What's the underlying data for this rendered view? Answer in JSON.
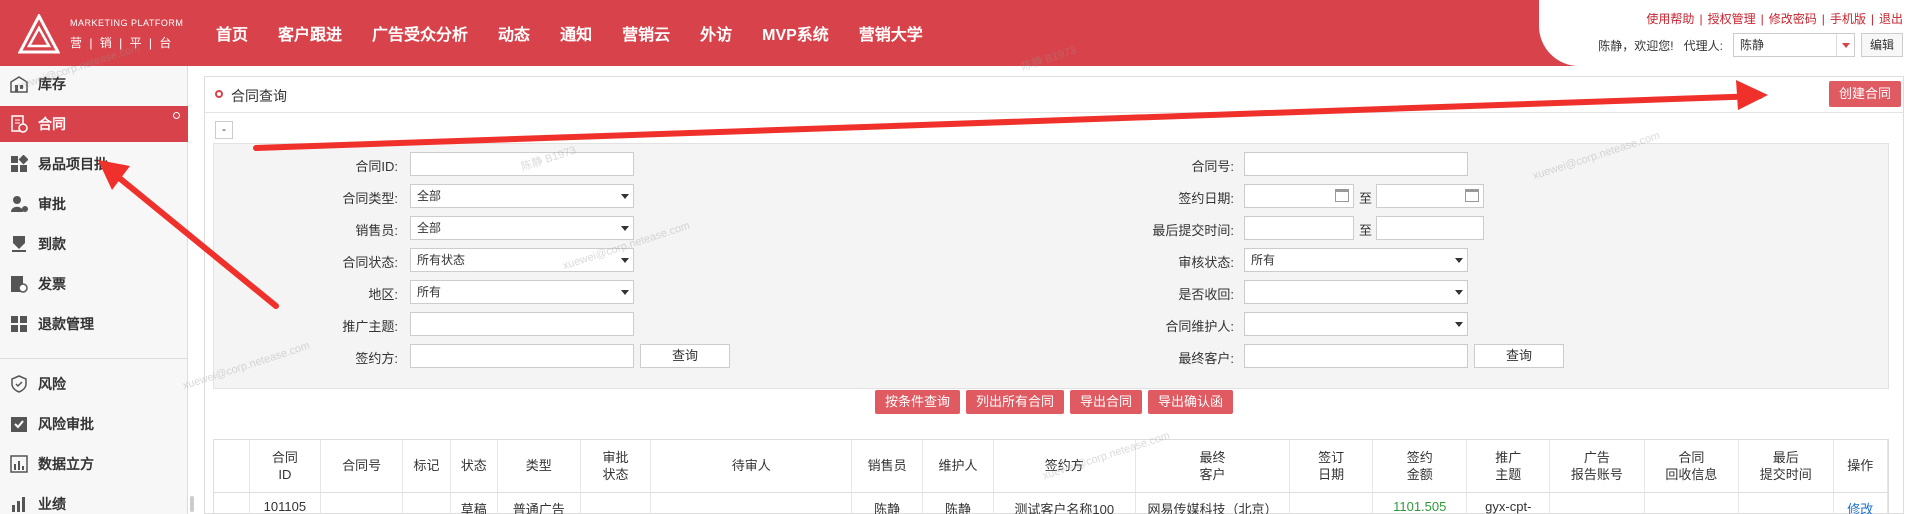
{
  "header": {
    "logo_en": "MARKETING PLATFORM",
    "logo_cn": "营 | 销 | 平 | 台",
    "nav": [
      "首页",
      "客户跟进",
      "广告受众分析",
      "动态",
      "通知",
      "营销云",
      "外访",
      "MVP系统",
      "营销大学"
    ],
    "top_links": [
      "使用帮助",
      "授权管理",
      "修改密码",
      "手机版",
      "退出"
    ],
    "welcome": "陈静，欢迎您!",
    "agent_label": "代理人:",
    "agent_value": "陈静",
    "edit_label": "编辑"
  },
  "sidebar": {
    "items": [
      {
        "label": "库存",
        "icon": "warehouse-icon"
      },
      {
        "label": "合同",
        "icon": "contract-icon"
      },
      {
        "label": "易品项目批",
        "icon": "grid-icon"
      },
      {
        "label": "审批",
        "icon": "approval-icon"
      },
      {
        "label": "到款",
        "icon": "payment-icon"
      },
      {
        "label": "发票",
        "icon": "invoice-icon"
      },
      {
        "label": "退款管理",
        "icon": "refund-icon"
      },
      {
        "label": "风险",
        "icon": "shield-icon"
      },
      {
        "label": "风险审批",
        "icon": "check-icon"
      },
      {
        "label": "数据立方",
        "icon": "chart-icon"
      },
      {
        "label": "业绩",
        "icon": "performance-icon"
      }
    ]
  },
  "panel": {
    "title": "合同查询",
    "create_label": "创建合同",
    "toggle_label": "-"
  },
  "form": {
    "left": {
      "contract_id": {
        "label": "合同ID:",
        "value": ""
      },
      "contract_type": {
        "label": "合同类型:",
        "value": "全部"
      },
      "salesperson": {
        "label": "销售员:",
        "value": "全部"
      },
      "contract_status": {
        "label": "合同状态:",
        "value": "所有状态"
      },
      "region": {
        "label": "地区:",
        "value": "所有"
      },
      "promo_theme": {
        "label": "推广主题:",
        "value": ""
      },
      "signing_party": {
        "label": "签约方:",
        "value": ""
      },
      "query_label": "查询"
    },
    "right": {
      "contract_no": {
        "label": "合同号:",
        "value": ""
      },
      "sign_date": {
        "label": "签约日期:",
        "to": "至"
      },
      "last_submit": {
        "label": "最后提交时间:",
        "to": "至"
      },
      "review_status": {
        "label": "审核状态:",
        "value": "所有"
      },
      "collected": {
        "label": "是否收回:",
        "value": ""
      },
      "maintainer": {
        "label": "合同维护人:",
        "value": ""
      },
      "final_customer": {
        "label": "最终客户:",
        "value": ""
      },
      "query_label": "查询"
    },
    "actions": [
      "按条件查询",
      "列出所有合同",
      "导出合同",
      "导出确认函"
    ]
  },
  "table": {
    "headers": [
      "",
      "合同\nID",
      "合同号",
      "标记",
      "状态",
      "类型",
      "审批\n状态",
      "待审人",
      "销售员",
      "维护人",
      "签约方",
      "最终\n客户",
      "签订\n日期",
      "签约\n金额",
      "推广\n主题",
      "广告\n报告账号",
      "合同\n回收信息",
      "最后\n提交时间",
      "操作"
    ],
    "rows": [
      [
        "",
        "101105",
        "",
        "",
        "草稿",
        "普通广告",
        "",
        "",
        "陈静",
        "陈静",
        "测试客户名称100",
        "网易传媒科技（北京）",
        "",
        "1101.505",
        "gyx-cpt-",
        "",
        "",
        "",
        "修改"
      ]
    ]
  },
  "watermark": {
    "name": "陈静 B1973",
    "email": "xuewei@corp.netease.com"
  },
  "colors": {
    "brand": "#d8434b",
    "button": "#e05a62",
    "arrow": "#f0302a"
  }
}
